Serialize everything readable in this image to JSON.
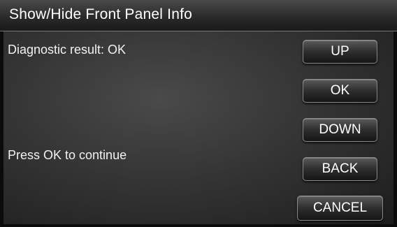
{
  "window": {
    "title": "Show/Hide Front Panel Info"
  },
  "messages": {
    "result": "Diagnostic result: OK",
    "continue": "Press OK to continue"
  },
  "buttons": {
    "up": "UP",
    "ok": "OK",
    "down": "DOWN",
    "back": "BACK",
    "cancel": "CANCEL"
  }
}
